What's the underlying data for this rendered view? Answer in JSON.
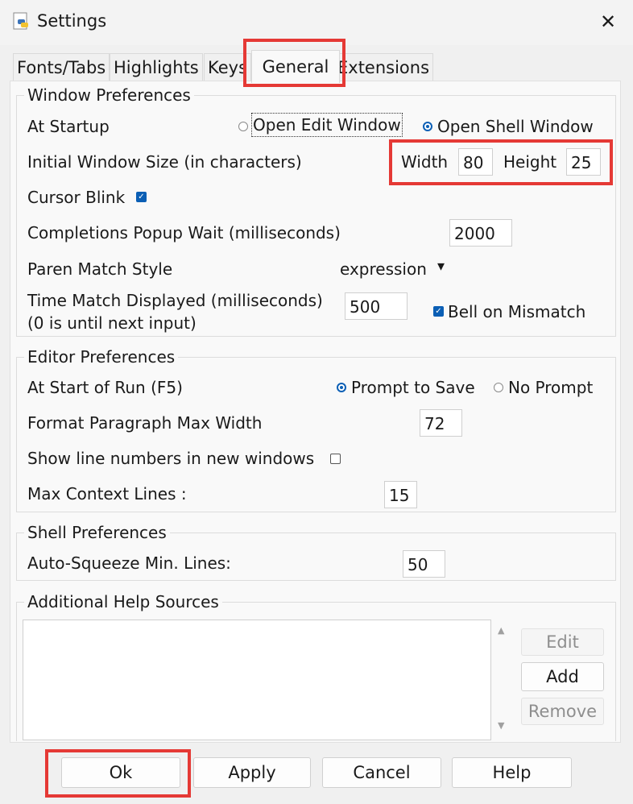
{
  "window": {
    "title": "Settings",
    "close_glyph": "✕",
    "icon": "python-icon"
  },
  "tabs": [
    "Fonts/Tabs",
    "Highlights",
    "Keys",
    "General",
    "Extensions"
  ],
  "active_tab": "General",
  "window_prefs": {
    "title": "Window Preferences",
    "startup_label": "At Startup",
    "startup_options": [
      "Open Edit Window",
      "Open Shell Window"
    ],
    "startup_selected": "Open Shell Window",
    "size_label": "Initial Window Size  (in characters)",
    "width_label": "Width",
    "width_value": "80",
    "height_label": "Height",
    "height_value": "25",
    "cursor_blink_label": "Cursor Blink",
    "cursor_blink": true,
    "popup_wait_label": "Completions Popup Wait (milliseconds)",
    "popup_wait_value": "2000",
    "paren_style_label": "Paren Match Style",
    "paren_style_value": "expression",
    "paren_arrow": "▾",
    "time_match_label": "Time Match Displayed (milliseconds)",
    "time_match_sub": "(0 is until next input)",
    "time_match_value": "500",
    "bell_label": "Bell on Mismatch",
    "bell": true
  },
  "editor_prefs": {
    "title": "Editor Preferences",
    "run_label": "At Start of Run (F5)",
    "run_options": [
      "Prompt to Save",
      "No Prompt"
    ],
    "run_selected": "Prompt to Save",
    "para_label": "Format Paragraph Max Width",
    "para_value": "72",
    "line_numbers_label": "Show line numbers in new windows",
    "line_numbers": false,
    "context_label": "Max Context Lines :",
    "context_value": "15"
  },
  "shell_prefs": {
    "title": "Shell Preferences",
    "squeeze_label": "Auto-Squeeze Min. Lines:",
    "squeeze_value": "50"
  },
  "help_sources": {
    "title": "Additional Help Sources",
    "items": [],
    "edit_label": "Edit",
    "add_label": "Add",
    "remove_label": "Remove",
    "scroll_up": "▲",
    "scroll_down": "▼"
  },
  "buttons": {
    "ok": "Ok",
    "apply": "Apply",
    "cancel": "Cancel",
    "help": "Help"
  },
  "colors": {
    "highlight": "#e53935",
    "accent": "#0b5fb5"
  }
}
